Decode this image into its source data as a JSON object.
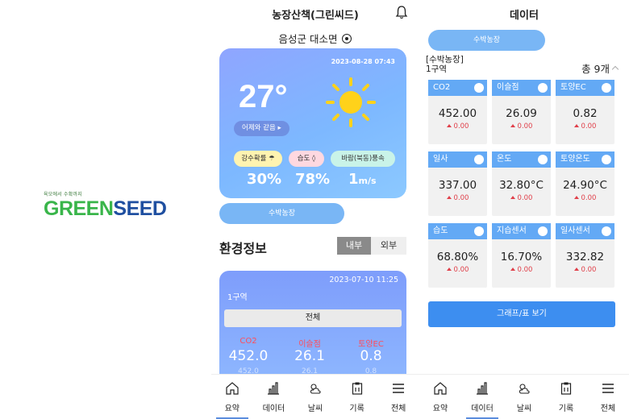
{
  "logo": {
    "tagline": "육모에서 수확까지",
    "word_green": "GREEN",
    "word_seed": "SEED"
  },
  "summary": {
    "title": "농장산책(그린씨드)",
    "location": "음성군 대소면",
    "weather": {
      "datetime": "2023-08-28 07:43",
      "temperature": "27°",
      "compare": "어제와 같음 ▸",
      "chips": [
        "강수확률 ☂",
        "습도 ◊",
        "바람(북동)풍속"
      ],
      "values": [
        "30%",
        "78%",
        "1"
      ],
      "wind_unit": "m/s"
    },
    "farm_button": "수박농장",
    "env_title": "환경정보",
    "segment": [
      "내부",
      "외부"
    ],
    "zone": {
      "datetime": "2023-07-10 11:25",
      "name": "1구역",
      "all_label": "전체",
      "labels": [
        "CO2",
        "이슬점",
        "토양EC"
      ],
      "values": [
        "452.0",
        "26.1",
        "0.8"
      ],
      "sub": [
        "452.0",
        "26.1",
        "0.8"
      ]
    }
  },
  "nav": [
    "요약",
    "데이터",
    "날씨",
    "기록",
    "전체"
  ],
  "data_screen": {
    "title": "데이터",
    "farm_button": "수박농장",
    "crumb_line1": "[수박농장]",
    "crumb_line2": "1구역",
    "count": "총 9개",
    "tiles": [
      {
        "label": "CO2",
        "value": "452.00",
        "delta": "0.00"
      },
      {
        "label": "이슬점",
        "value": "26.09",
        "delta": "0.00"
      },
      {
        "label": "토양EC",
        "value": "0.82",
        "delta": "0.00"
      },
      {
        "label": "일사",
        "value": "337.00",
        "delta": "0.00"
      },
      {
        "label": "온도",
        "value": "32.80°C",
        "delta": "0.00"
      },
      {
        "label": "토양온도",
        "value": "24.90°C",
        "delta": "0.00"
      },
      {
        "label": "습도",
        "value": "68.80%",
        "delta": "0.00"
      },
      {
        "label": "지습센서",
        "value": "16.70%",
        "delta": "0.00"
      },
      {
        "label": "일사센서",
        "value": "332.82",
        "delta": "0.00"
      }
    ],
    "graph_button": "그래프/표 보기"
  },
  "colors": {
    "accent": "#79b6f5",
    "tile_header": "#63a9f5",
    "primary_button": "#3d8ef0",
    "delta_red": "#e0404a"
  }
}
